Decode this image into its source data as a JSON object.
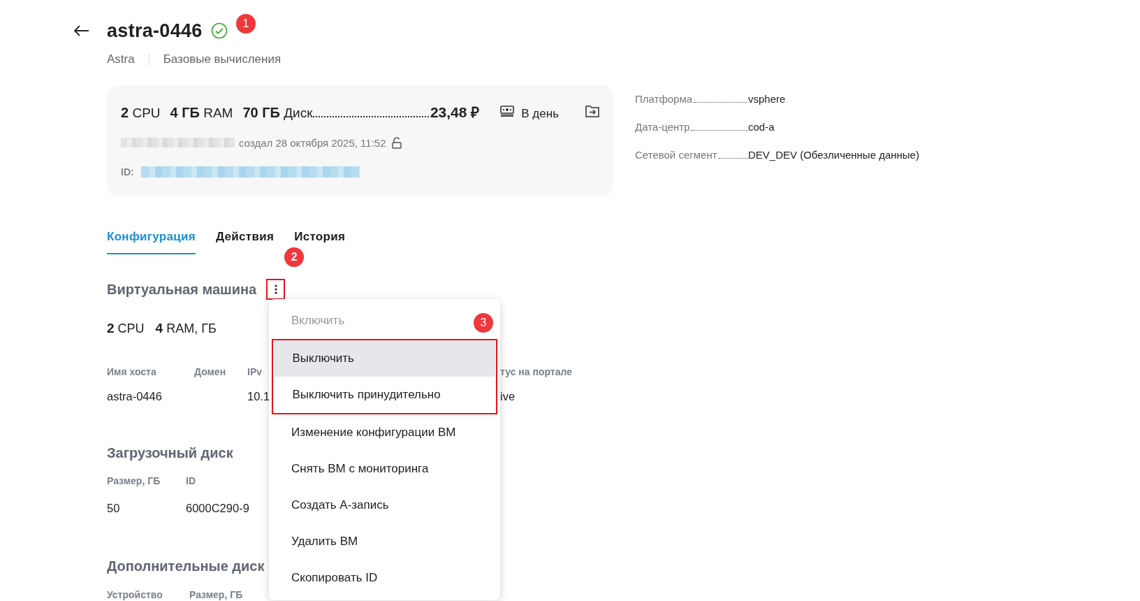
{
  "header": {
    "title": "astra-0446",
    "verified": true,
    "badge": "1",
    "breadcrumbs": [
      "Astra",
      "Базовые вычисления"
    ]
  },
  "summary": {
    "specs": [
      {
        "value": "2",
        "unit": "CPU"
      },
      {
        "value": "4 ГБ",
        "unit": "RAM"
      },
      {
        "value": "70 ГБ",
        "unit": "Диск"
      }
    ],
    "price": "23,48 ₽",
    "period": "В день",
    "created": "создал 28 октября 2025, 11:52",
    "locked": false,
    "id_label": "ID:"
  },
  "properties": [
    {
      "label": "Платформа",
      "value": "vsphere"
    },
    {
      "label": "Дата-центр",
      "value": "cod-a"
    },
    {
      "label": "Сетевой сегмент",
      "value": "DEV_DEV (Обезличенные данные)"
    }
  ],
  "tabs": [
    {
      "label": "Конфигурация",
      "selected": true
    },
    {
      "label": "Действия",
      "selected": false
    },
    {
      "label": "История",
      "selected": false
    }
  ],
  "vm": {
    "title": "Виртуальная машина",
    "menu_badge": "2",
    "specs": [
      {
        "value": "2",
        "unit": "CPU"
      },
      {
        "value": "4",
        "unit": "RAM, ГБ"
      }
    ],
    "columns": [
      {
        "header": "Имя хоста",
        "value": "astra-0446"
      },
      {
        "header": "Домен"
      },
      {
        "header": "IPv",
        "value": "10.1"
      },
      {
        "header": "тус на портале",
        "value": "ive"
      }
    ]
  },
  "boot_disk": {
    "title": "Загрузочный диск",
    "columns": [
      {
        "header": "Размер, ГБ",
        "value": "50"
      },
      {
        "header": "ID",
        "value": "6000C290-9"
      }
    ]
  },
  "extra_disks": {
    "title": "Дополнительные диск",
    "columns": [
      {
        "header": "Устройство"
      },
      {
        "header": "Размер, ГБ"
      }
    ]
  },
  "menu": {
    "badge": "3",
    "items": [
      {
        "label": "Включить",
        "disabled": true,
        "selected": false,
        "marked": false
      },
      {
        "label": "Выключить",
        "disabled": false,
        "selected": true,
        "marked": true
      },
      {
        "label": "Выключить принудительно",
        "disabled": false,
        "selected": false,
        "marked": true
      },
      {
        "label": "Изменение конфигурации ВМ",
        "disabled": false,
        "selected": false,
        "marked": false
      },
      {
        "label": "Снять ВМ с мониторинга",
        "disabled": false,
        "selected": false,
        "marked": false
      },
      {
        "label": "Создать А-запись",
        "disabled": false,
        "selected": false,
        "marked": false
      },
      {
        "label": "Удалить ВМ",
        "disabled": false,
        "selected": false,
        "marked": false
      },
      {
        "label": "Скопировать ID",
        "disabled": false,
        "selected": false,
        "marked": false
      }
    ]
  }
}
